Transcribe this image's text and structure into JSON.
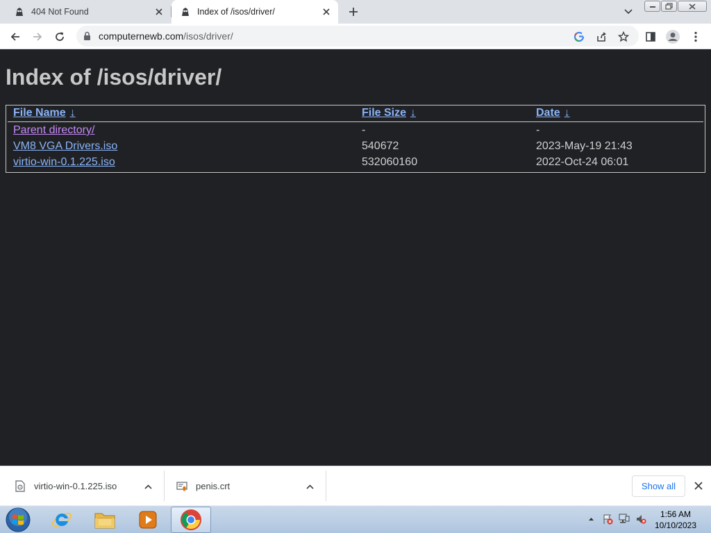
{
  "tabs": [
    {
      "title": "404 Not Found",
      "active": false
    },
    {
      "title": "Index of /isos/driver/",
      "active": true
    }
  ],
  "address_bar": {
    "domain": "computernewb.com",
    "path": "/isos/driver/"
  },
  "page": {
    "heading": "Index of /isos/driver/",
    "columns": [
      {
        "label": "File Name",
        "sort_arrow": "↓"
      },
      {
        "label": "File Size",
        "sort_arrow": "↓"
      },
      {
        "label": "Date",
        "sort_arrow": "↓"
      }
    ],
    "rows": [
      {
        "name": "Parent directory/",
        "size": "-",
        "date": "-",
        "visited": true
      },
      {
        "name": "VM8 VGA Drivers.iso",
        "size": "540672",
        "date": "2023-May-19 21:43",
        "visited": false
      },
      {
        "name": "virtio-win-0.1.225.iso",
        "size": "532060160",
        "date": "2022-Oct-24 06:01",
        "visited": false
      }
    ]
  },
  "downloads": {
    "items": [
      {
        "filename": "virtio-win-0.1.225.iso",
        "icon": "iso-file-icon"
      },
      {
        "filename": "penis.crt",
        "icon": "certificate-file-icon"
      }
    ],
    "show_all_label": "Show all"
  },
  "taskbar": {
    "apps": [
      "internet-explorer",
      "file-explorer",
      "media-player",
      "google-chrome"
    ],
    "active_app": "google-chrome",
    "time": "1:56 AM",
    "date": "10/10/2023"
  },
  "colors": {
    "page_bg": "#202124",
    "link": "#8ab4f8",
    "visited_link": "#c58af9",
    "text": "#d0d0d0",
    "accent": "#1a73e8"
  }
}
